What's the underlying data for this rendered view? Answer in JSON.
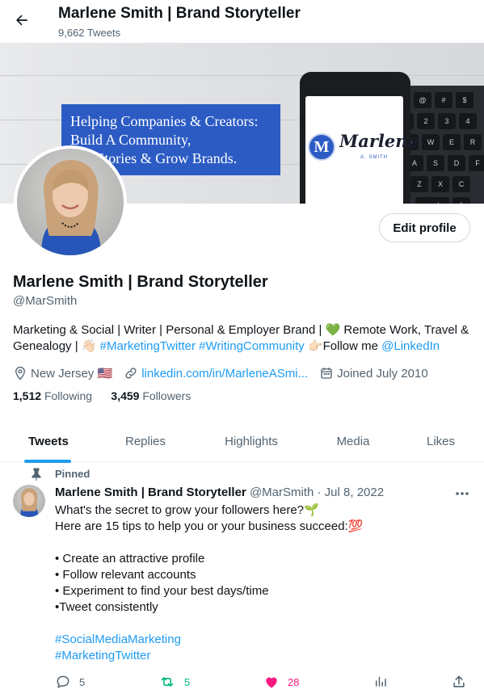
{
  "header": {
    "title": "Marlene Smith | Brand Storyteller",
    "tweet_count": "9,662 Tweets"
  },
  "banner": {
    "lines": [
      "Helping Companies & Creators:",
      "Build A Community,",
      "Tell Stories & Grow Brands."
    ],
    "logo_letter": "M",
    "logo_text": "Marlene",
    "logo_sub": "A. SMITH"
  },
  "profile": {
    "edit_label": "Edit profile",
    "name": "Marlene Smith | Brand Storyteller",
    "handle": "@MarSmith",
    "bio_line1": "Marketing & Social | Writer | Personal & Employer Brand | 💚 Remote Work, Travel &",
    "bio_line2_a": "Genealogy | 👋🏻 ",
    "bio_line2_tags": "#MarketingTwitter #WritingCommunity",
    "bio_line2_b": " 👉🏻Follow me ",
    "bio_line2_link": "@LinkedIn",
    "location": "New Jersey 🇺🇸",
    "website": "linkedin.com/in/MarleneASmi...",
    "joined": "Joined July 2010",
    "following_count": "1,512",
    "following_label": "Following",
    "followers_count": "3,459",
    "followers_label": "Followers"
  },
  "tabs": [
    {
      "label": "Tweets"
    },
    {
      "label": "Replies"
    },
    {
      "label": "Highlights"
    },
    {
      "label": "Media"
    },
    {
      "label": "Likes"
    }
  ],
  "tweet": {
    "pinned_label": "Pinned",
    "author": "Marlene Smith | Brand Storyteller",
    "handle_date": "@MarSmith · Jul 8, 2022",
    "lines": [
      "What's the secret to grow your followers here?🌱",
      "Here are 15 tips to help you or your business succeed:💯",
      "",
      "• Create an attractive profile",
      "• Follow relevant accounts",
      "• Experiment to find your best days/time",
      "•Tweet consistently",
      ""
    ],
    "hashtags": [
      "#SocialMediaMarketing",
      "#MarketingTwitter"
    ],
    "replies": "5",
    "retweets": "5",
    "likes": "28"
  },
  "colors": {
    "accent": "#1d9bf0",
    "retweet": "#00ba7c",
    "like": "#f91880",
    "banner_card": "#2c5bc4"
  }
}
